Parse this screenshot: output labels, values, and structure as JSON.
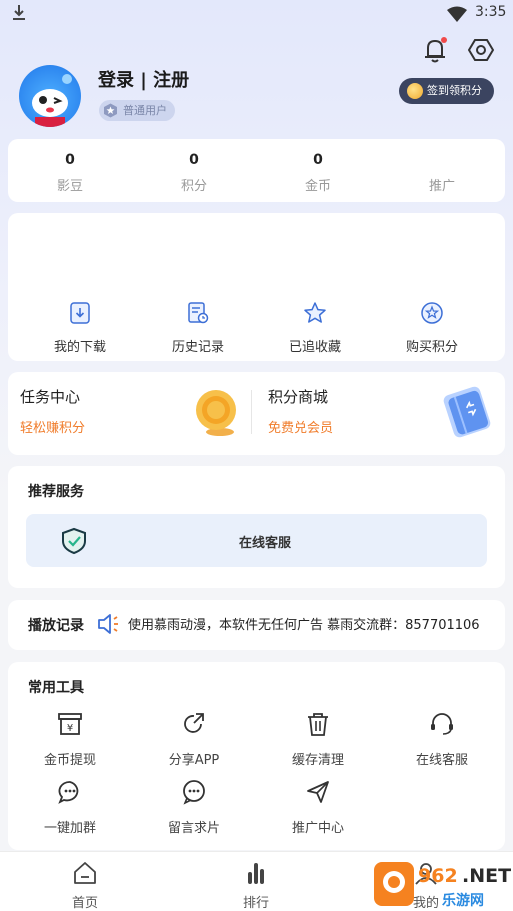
{
  "status_bar": {
    "time": "3:35"
  },
  "header": {
    "login_text": "登录 | 注册",
    "user_level": "普通用户",
    "sign_in_button": "签到领积分"
  },
  "stats": [
    {
      "value": "0",
      "label": "影豆"
    },
    {
      "value": "0",
      "label": "积分"
    },
    {
      "value": "0",
      "label": "金币"
    },
    {
      "value": "",
      "label": "推广"
    }
  ],
  "quick_actions": [
    {
      "label": "我的下载",
      "icon": "download-icon"
    },
    {
      "label": "历史记录",
      "icon": "history-icon"
    },
    {
      "label": "已追收藏",
      "icon": "star-icon"
    },
    {
      "label": "购买积分",
      "icon": "points-icon"
    }
  ],
  "task_center": {
    "title": "任务中心",
    "subtitle": "轻松赚积分"
  },
  "points_mall": {
    "title": "积分商城",
    "subtitle": "免费兑会员"
  },
  "recommended": {
    "title": "推荐服务",
    "service_label": "在线客服"
  },
  "play_history": {
    "title": "播放记录",
    "notice": "使用慕雨动漫，本软件无任何广告 慕雨交流群：857701106"
  },
  "tools": {
    "title": "常用工具",
    "items": [
      {
        "label": "金币提现",
        "icon": "wallet-icon"
      },
      {
        "label": "分享APP",
        "icon": "share-icon"
      },
      {
        "label": "缓存清理",
        "icon": "trash-icon"
      },
      {
        "label": "在线客服",
        "icon": "headset-icon"
      },
      {
        "label": "一键加群",
        "icon": "chat-icon"
      },
      {
        "label": "留言求片",
        "icon": "message-icon"
      },
      {
        "label": "推广中心",
        "icon": "send-icon"
      }
    ]
  },
  "bottom_nav": [
    {
      "label": "首页",
      "icon": "home-icon"
    },
    {
      "label": "排行",
      "icon": "ranking-icon"
    },
    {
      "label": "我的",
      "icon": "profile-icon"
    }
  ],
  "watermark": {
    "brand": "962.NET",
    "site": "乐游网"
  },
  "colors": {
    "accent_orange": "#f07d2c",
    "icon_blue": "#3d6fd6",
    "sign_button": "#3b4460"
  }
}
